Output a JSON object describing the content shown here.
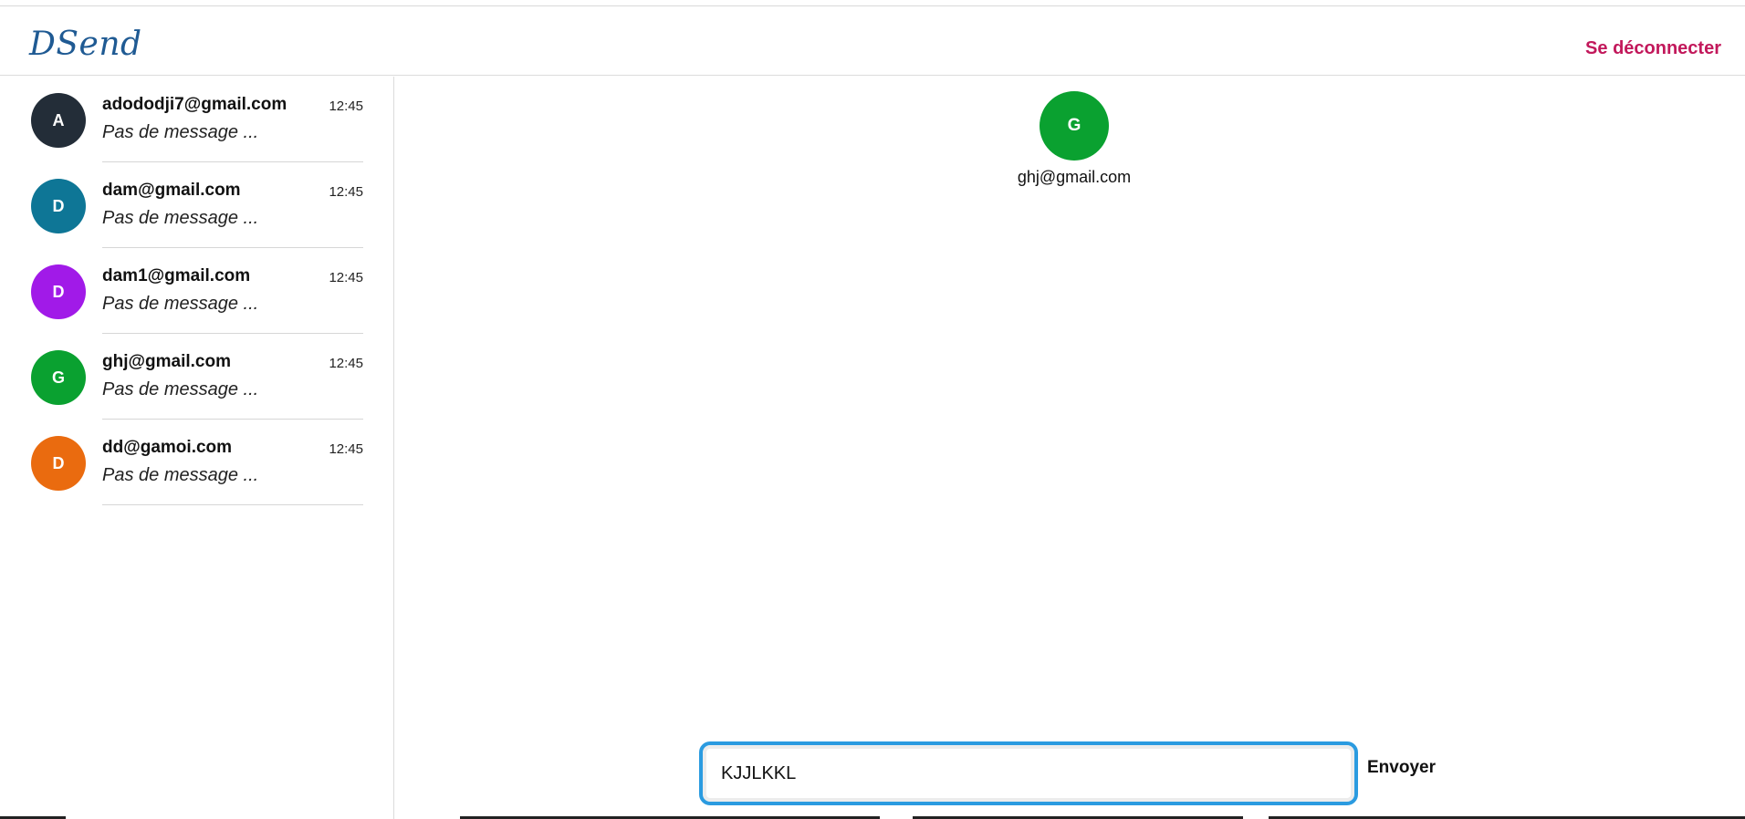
{
  "app": {
    "logo": "DSend",
    "logout_label": "Se déconnecter"
  },
  "conversations": [
    {
      "initial": "A",
      "email": "adododji7@gmail.com",
      "time": "12:45",
      "preview": "Pas de message ...",
      "color": "#232d38"
    },
    {
      "initial": "D",
      "email": "dam@gmail.com",
      "time": "12:45",
      "preview": "Pas de message ...",
      "color": "#0e7696"
    },
    {
      "initial": "D",
      "email": "dam1@gmail.com",
      "time": "12:45",
      "preview": "Pas de message ...",
      "color": "#a11ae8"
    },
    {
      "initial": "G",
      "email": "ghj@gmail.com",
      "time": "12:45",
      "preview": "Pas de message ...",
      "color": "#0aa130"
    },
    {
      "initial": "D",
      "email": "dd@gamoi.com",
      "time": "12:45",
      "preview": "Pas de message ...",
      "color": "#ea6b0f"
    }
  ],
  "chat": {
    "contact_initial": "G",
    "contact_email": "ghj@gmail.com",
    "message_value": "KJJLKKL",
    "send_label": "Envoyer"
  },
  "colors": {
    "logo": "#1f5a93",
    "logout": "#c2185b",
    "input_focus": "#2b9be0",
    "contact_avatar": "#0aa130"
  }
}
